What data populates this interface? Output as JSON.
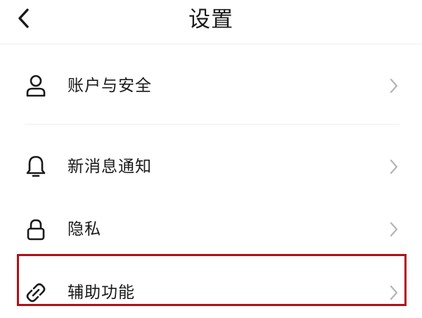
{
  "header": {
    "title": "设置",
    "back_icon": "chevron-left-icon"
  },
  "settings": {
    "items": [
      {
        "label": "账户与安全",
        "icon": "user-icon"
      },
      {
        "label": "新消息通知",
        "icon": "bell-icon"
      },
      {
        "label": "隐私",
        "icon": "lock-icon"
      },
      {
        "label": "辅助功能",
        "icon": "link-icon"
      }
    ],
    "chevron_icon": "chevron-right-icon"
  },
  "colors": {
    "text": "#1a1a1a",
    "chevron": "#b4b4b4",
    "highlight_border": "#b30f14",
    "divider": "#eeeeee"
  }
}
